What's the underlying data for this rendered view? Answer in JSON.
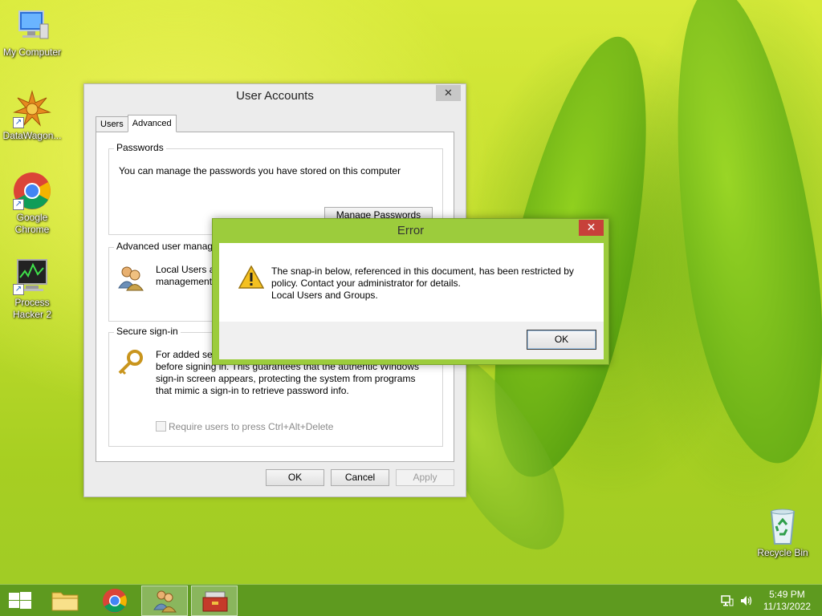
{
  "desktop": {
    "icons": [
      {
        "label": "My Computer"
      },
      {
        "label": "DataWagon..."
      },
      {
        "label": "Google\nChrome"
      },
      {
        "label": "Process\nHacker 2"
      },
      {
        "label": "Recycle Bin"
      }
    ]
  },
  "user_accounts": {
    "title": "User Accounts",
    "close_glyph": "✕",
    "tabs": [
      {
        "label": "Users"
      },
      {
        "label": "Advanced"
      }
    ],
    "passwords": {
      "title": "Passwords",
      "description": "You can manage the passwords you have stored on this computer",
      "button": "Manage Passwords"
    },
    "advanced_mgmt": {
      "title": "Advanced user manage",
      "description": "Local Users ar\nmanagement"
    },
    "secure_signin": {
      "title": "Secure sign-in",
      "description": "For added sec\nbefore signing in. This guarantees that the authentic Windows\nsign-in screen appears, protecting the system from programs\nthat mimic a sign-in to retrieve password info.",
      "checkbox_label": "Require users to press Ctrl+Alt+Delete",
      "checkbox_checked": false
    },
    "buttons": {
      "ok": "OK",
      "cancel": "Cancel",
      "apply": "Apply"
    }
  },
  "error_dialog": {
    "title": "Error",
    "close_glyph": "✕",
    "message": "The snap-in below, referenced in this document, has been restricted by\npolicy. Contact your administrator for details.\nLocal Users and Groups.",
    "ok": "OK"
  },
  "taskbar": {
    "time": "5:49 PM",
    "date": "11/13/2022"
  }
}
